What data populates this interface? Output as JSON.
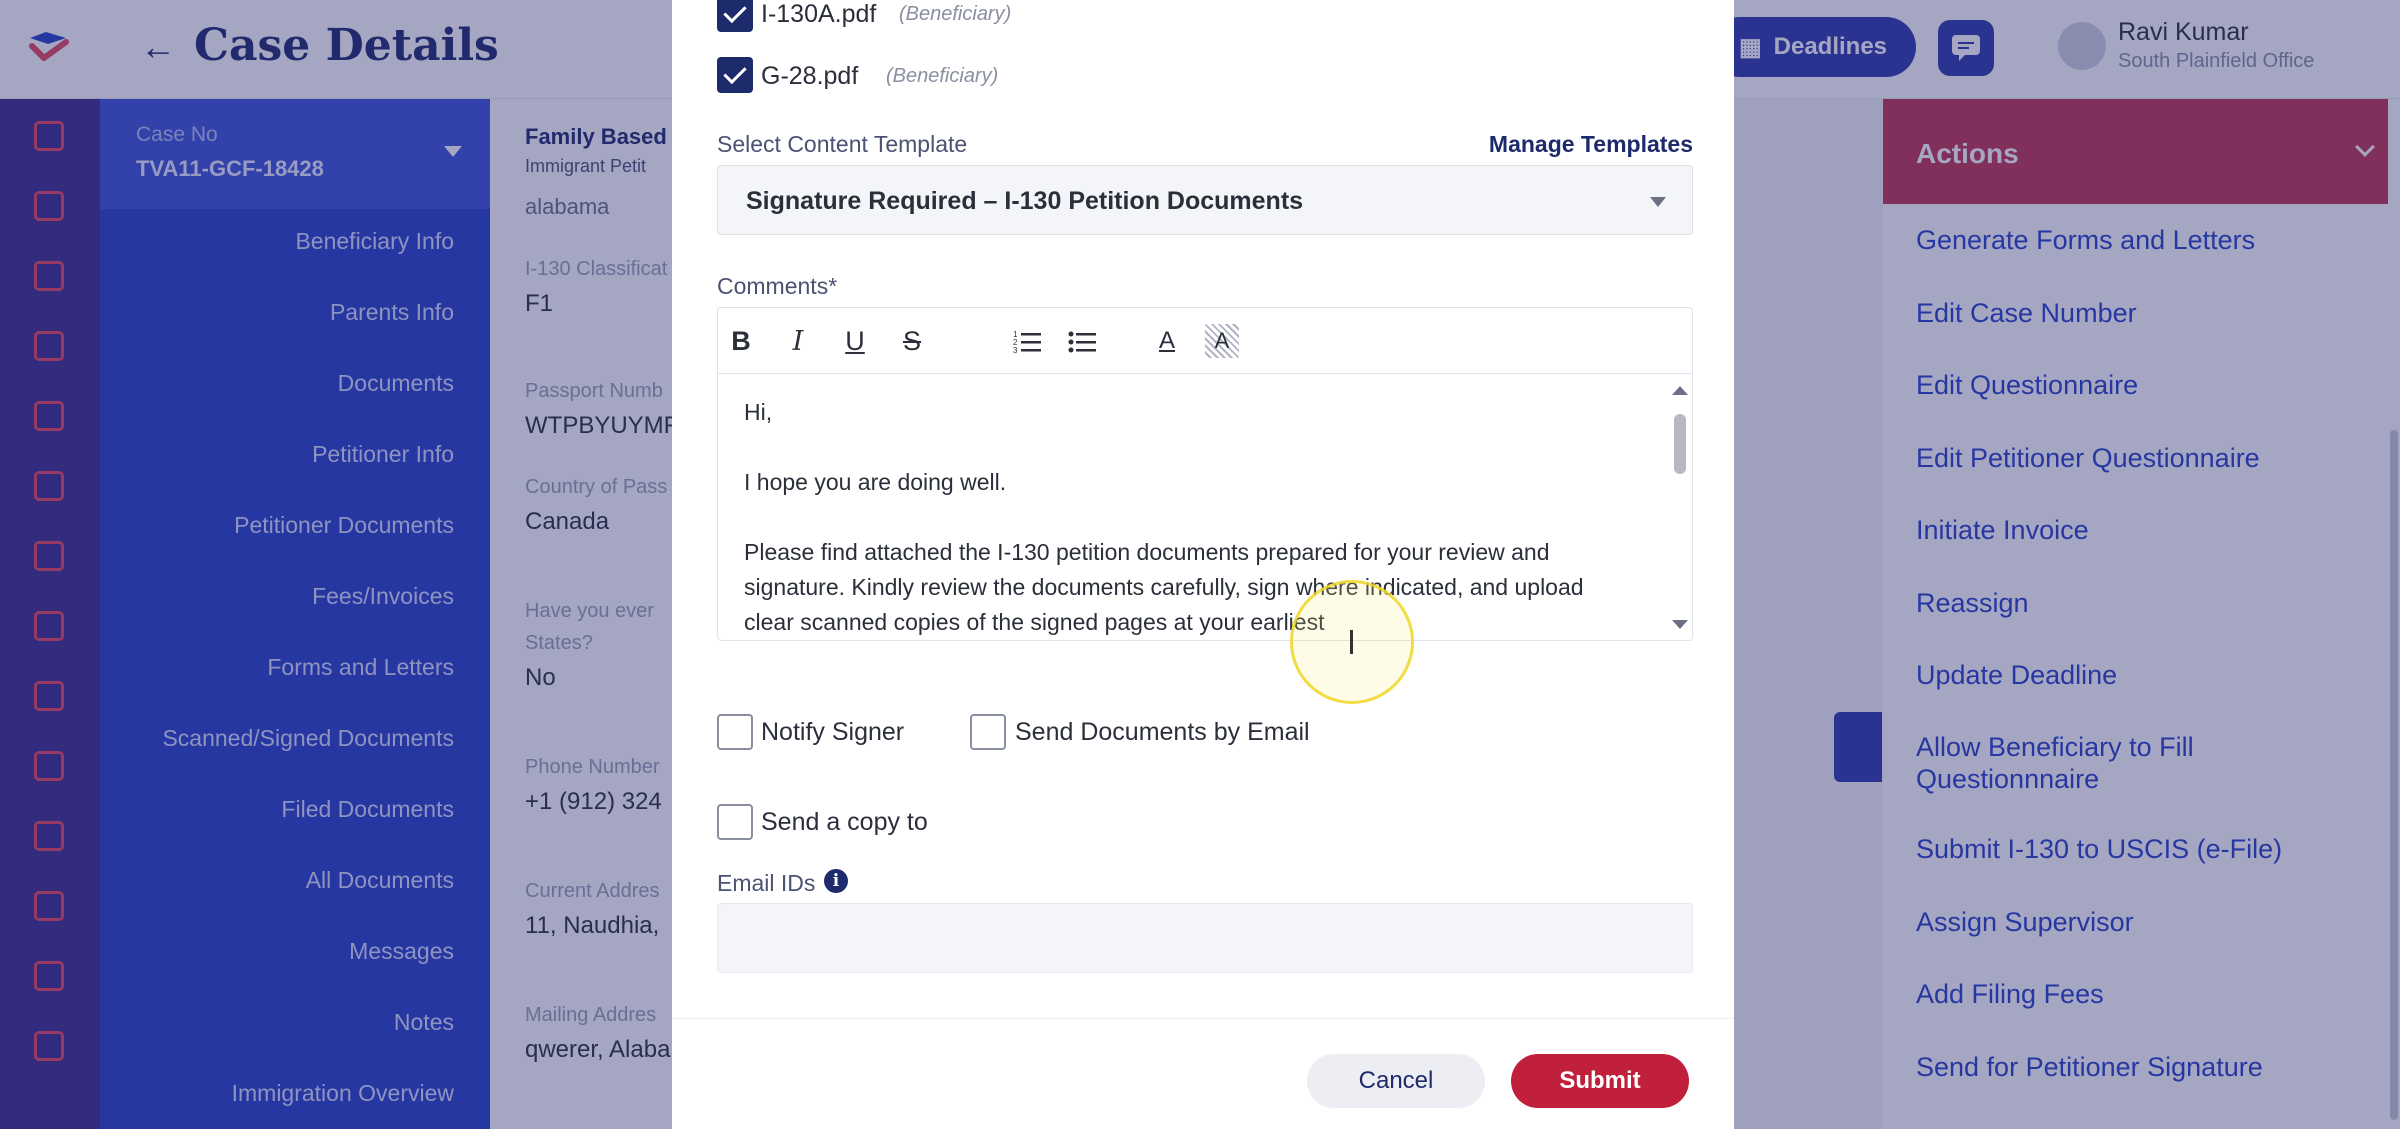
{
  "header": {
    "title": "Case Details",
    "deadlines_label": "Deadlines",
    "user_name": "Ravi Kumar",
    "user_office": "South Plainfield Office"
  },
  "case": {
    "case_no_label": "Case No",
    "case_no": "TVA11-GCF-18428",
    "family_label": "Family Based",
    "family_sub": "Immigrant Petit"
  },
  "nav": {
    "items": [
      "Beneficiary Info",
      "Parents Info",
      "Documents",
      "Petitioner Info",
      "Petitioner Documents",
      "Fees/Invoices",
      "Forms and Letters",
      "Scanned/Signed Documents",
      "Filed Documents",
      "All Documents",
      "Messages",
      "Notes",
      "Immigration Overview"
    ]
  },
  "info": {
    "top_value": "alabama",
    "fields": [
      {
        "label": "I-130 Classificat",
        "value": "F1"
      },
      {
        "label": "Passport Numb",
        "value": "WTPBYUYMF"
      },
      {
        "label": "Country of Pass",
        "value": "Canada"
      },
      {
        "label": "Have you ever",
        "label2": "States?",
        "value": "No"
      },
      {
        "label": "Phone Number",
        "value": "+1 (912) 324"
      },
      {
        "label": "Current Addres",
        "value": "11, Naudhia,"
      },
      {
        "label": "Mailing Addres",
        "value": "qwerer, Alaba"
      }
    ]
  },
  "actions": {
    "title": "Actions",
    "items": [
      "Generate Forms and Letters",
      "Edit Case Number",
      "Edit Questionnaire",
      "Edit Petitioner Questionnaire",
      "Initiate Invoice",
      "Reassign",
      "Update Deadline",
      "Allow Beneficiary to Fill Questionnnaire",
      "Submit I-130 to USCIS (e-File)",
      "Assign Supervisor",
      "Add Filing Fees",
      "Send for Petitioner Signature"
    ]
  },
  "modal": {
    "files": [
      {
        "name": "I-130A.pdf",
        "tag": "(Beneficiary)",
        "checked": true
      },
      {
        "name": "G-28.pdf",
        "tag": "(Beneficiary)",
        "checked": true
      }
    ],
    "template_label": "Select Content Template",
    "manage_templates": "Manage Templates",
    "template_value": "Signature Required – I-130 Petition Documents",
    "comments_label": "Comments*",
    "toolbar": {
      "bold": "B",
      "italic": "I",
      "underline": "U",
      "strike": "S",
      "font_color": "A",
      "bg_color": "A"
    },
    "editor": {
      "line1": "Hi,",
      "line2": "I hope you are doing well.",
      "line3": "Please find attached the I-130 petition documents prepared for your review and signature. Kindly review the documents carefully, sign where indicated, and upload clear scanned copies of the signed pages at your earliest"
    },
    "notify_signer": "Notify Signer",
    "send_by_email": "Send Documents by Email",
    "send_copy_to": "Send a copy to",
    "email_ids_label": "Email IDs",
    "email_placeholder": "",
    "cancel": "Cancel",
    "submit": "Submit"
  },
  "colors": {
    "brand_navy": "#1d2a6b",
    "nav_blue": "#2740c9",
    "accent_red": "#c0203c",
    "overlay": "rgba(40,44,110,0.42)"
  }
}
